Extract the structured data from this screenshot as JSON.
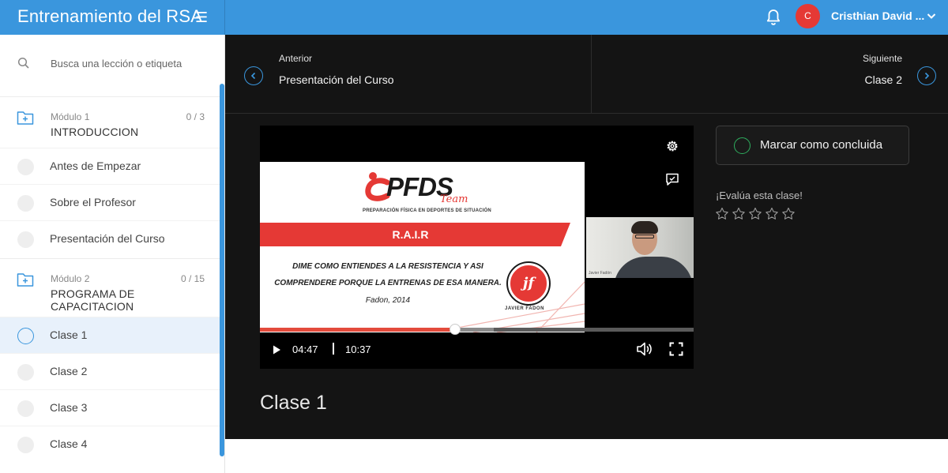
{
  "header": {
    "title": "Entrenamiento del RSA",
    "menu_icon": "hamburger-icon",
    "notifications_icon": "bell-icon",
    "user": {
      "avatar_initial": "C",
      "avatar_color": "#e53935",
      "name": "Cristhian David ..."
    }
  },
  "colors": {
    "accent": "#3a96dd",
    "dark_bg": "#141414",
    "complete_green": "#2eae5f",
    "progress_red": "#e34b3c"
  },
  "sidebar": {
    "search": {
      "placeholder": "Busca una lección o etiqueta"
    },
    "modules": [
      {
        "label": "Módulo 1",
        "count": "0 / 3",
        "name": "INTRODUCCION",
        "lessons": [
          "Antes de Empezar",
          "Sobre el Profesor",
          "Presentación del Curso"
        ]
      },
      {
        "label": "Módulo 2",
        "count": "0 / 15",
        "name": "PROGRAMA DE CAPACITACION",
        "lessons": [
          "Clase 1",
          "Clase 2",
          "Clase 3",
          "Clase 4"
        ]
      }
    ],
    "active_lesson": "Clase 1"
  },
  "navigation": {
    "previous": {
      "label": "Anterior",
      "title": "Presentación del Curso"
    },
    "next": {
      "label": "Siguiente",
      "title": "Clase 2"
    }
  },
  "video": {
    "slide": {
      "logo_text": "PFDS",
      "logo_script": "Team",
      "logo_subtitle": "PREPARACIÓN FÍSICA EN DEPORTES DE SITUACIÓN",
      "heading": "R.A.I.R",
      "line1": "DIME COMO ENTIENDES A LA RESISTENCIA Y ASI",
      "line2": "COMPRENDERE PORQUE LA ENTRENAS DE ESA MANERA.",
      "line3": "Fadon, 2014",
      "badge_text": "jf",
      "badge_name": "JAVIER FADON"
    },
    "webcam_tag": "Javier Fadón",
    "current_time": "04:47",
    "total_time": "10:37",
    "played_fraction": 0.45,
    "buffered_fraction": 0.54,
    "icons": [
      "gear-icon",
      "caption-icon",
      "play-icon",
      "volume-icon",
      "fullscreen-icon"
    ]
  },
  "actions": {
    "mark_complete": "Marcar como concluida",
    "rate_label": "¡Evalúa esta clase!",
    "rating": {
      "value": 0,
      "max": 5
    }
  },
  "lesson_title": "Clase 1"
}
